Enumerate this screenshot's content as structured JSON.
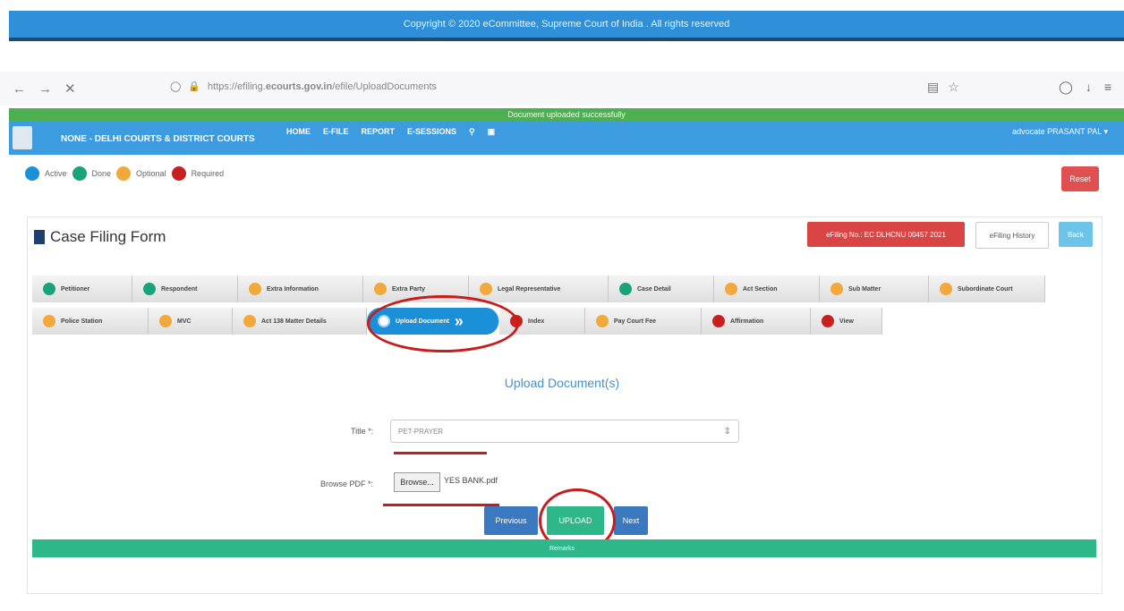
{
  "top_banner": "Copyright © 2020 eCommittee, Supreme Court of India . All rights reserved",
  "browser": {
    "back": "←",
    "forward": "→",
    "close": "✕",
    "url_prefix": "https://efiling.",
    "url_bold": "ecourts.gov.in",
    "url_suffix": "/efile/UploadDocuments"
  },
  "notification": "Document uploaded successfully",
  "navbar": {
    "court": "NONE - DELHI COURTS & DISTRICT COURTS",
    "menu": [
      "HOME",
      "E-FILE",
      "REPORT",
      "E-SESSIONS"
    ],
    "user": "advocate PRASANT PAL ▾"
  },
  "legend": [
    {
      "label": "Active",
      "color": "#1b8fd8"
    },
    {
      "label": "Done",
      "color": "#1aa37a"
    },
    {
      "label": "Optional",
      "color": "#f2a93b"
    },
    {
      "label": "Required",
      "color": "#c82020"
    }
  ],
  "reset_label": "Reset",
  "form_title": "Case Filing Form",
  "header_buttons": {
    "efiling_no": "eFiling No.: EC DLHCNU 00457 2021",
    "history": "eFiling History",
    "back": "Back"
  },
  "steps_row1": [
    {
      "label": "Petitioner",
      "color": "#1aa37a"
    },
    {
      "label": "Respondent",
      "color": "#1aa37a"
    },
    {
      "label": "Extra Information",
      "color": "#f2a93b"
    },
    {
      "label": "Extra Party",
      "color": "#f2a93b"
    },
    {
      "label": "Legal Representative",
      "color": "#f2a93b"
    },
    {
      "label": "Case Detail",
      "color": "#1aa37a"
    },
    {
      "label": "Act Section",
      "color": "#f2a93b"
    },
    {
      "label": "Sub Matter",
      "color": "#f2a93b"
    },
    {
      "label": "Subordinate Court",
      "color": "#f2a93b"
    }
  ],
  "steps_row2": [
    {
      "label": "Police Station",
      "color": "#f2a93b"
    },
    {
      "label": "MVC",
      "color": "#f2a93b"
    },
    {
      "label": "Act 138 Matter Details",
      "color": "#f2a93b"
    },
    {
      "label": "Upload Document",
      "color": "#ffffff",
      "active": true
    },
    {
      "label": "Index",
      "color": "#c82020"
    },
    {
      "label": "Pay Court Fee",
      "color": "#f2a93b"
    },
    {
      "label": "Affirmation",
      "color": "#c82020"
    },
    {
      "label": "View",
      "color": "#c82020"
    }
  ],
  "upload": {
    "heading": "Upload Document(s)",
    "title_label": "Title *:",
    "title_value": "PET-PRAYER",
    "browse_label": "Browse PDF *:",
    "browse_button": "Browse...",
    "file_name": "YES BANK.pdf",
    "prev": "Previous",
    "upload": "UPLOAD",
    "next": "Next"
  },
  "footer_text": "Remarks"
}
